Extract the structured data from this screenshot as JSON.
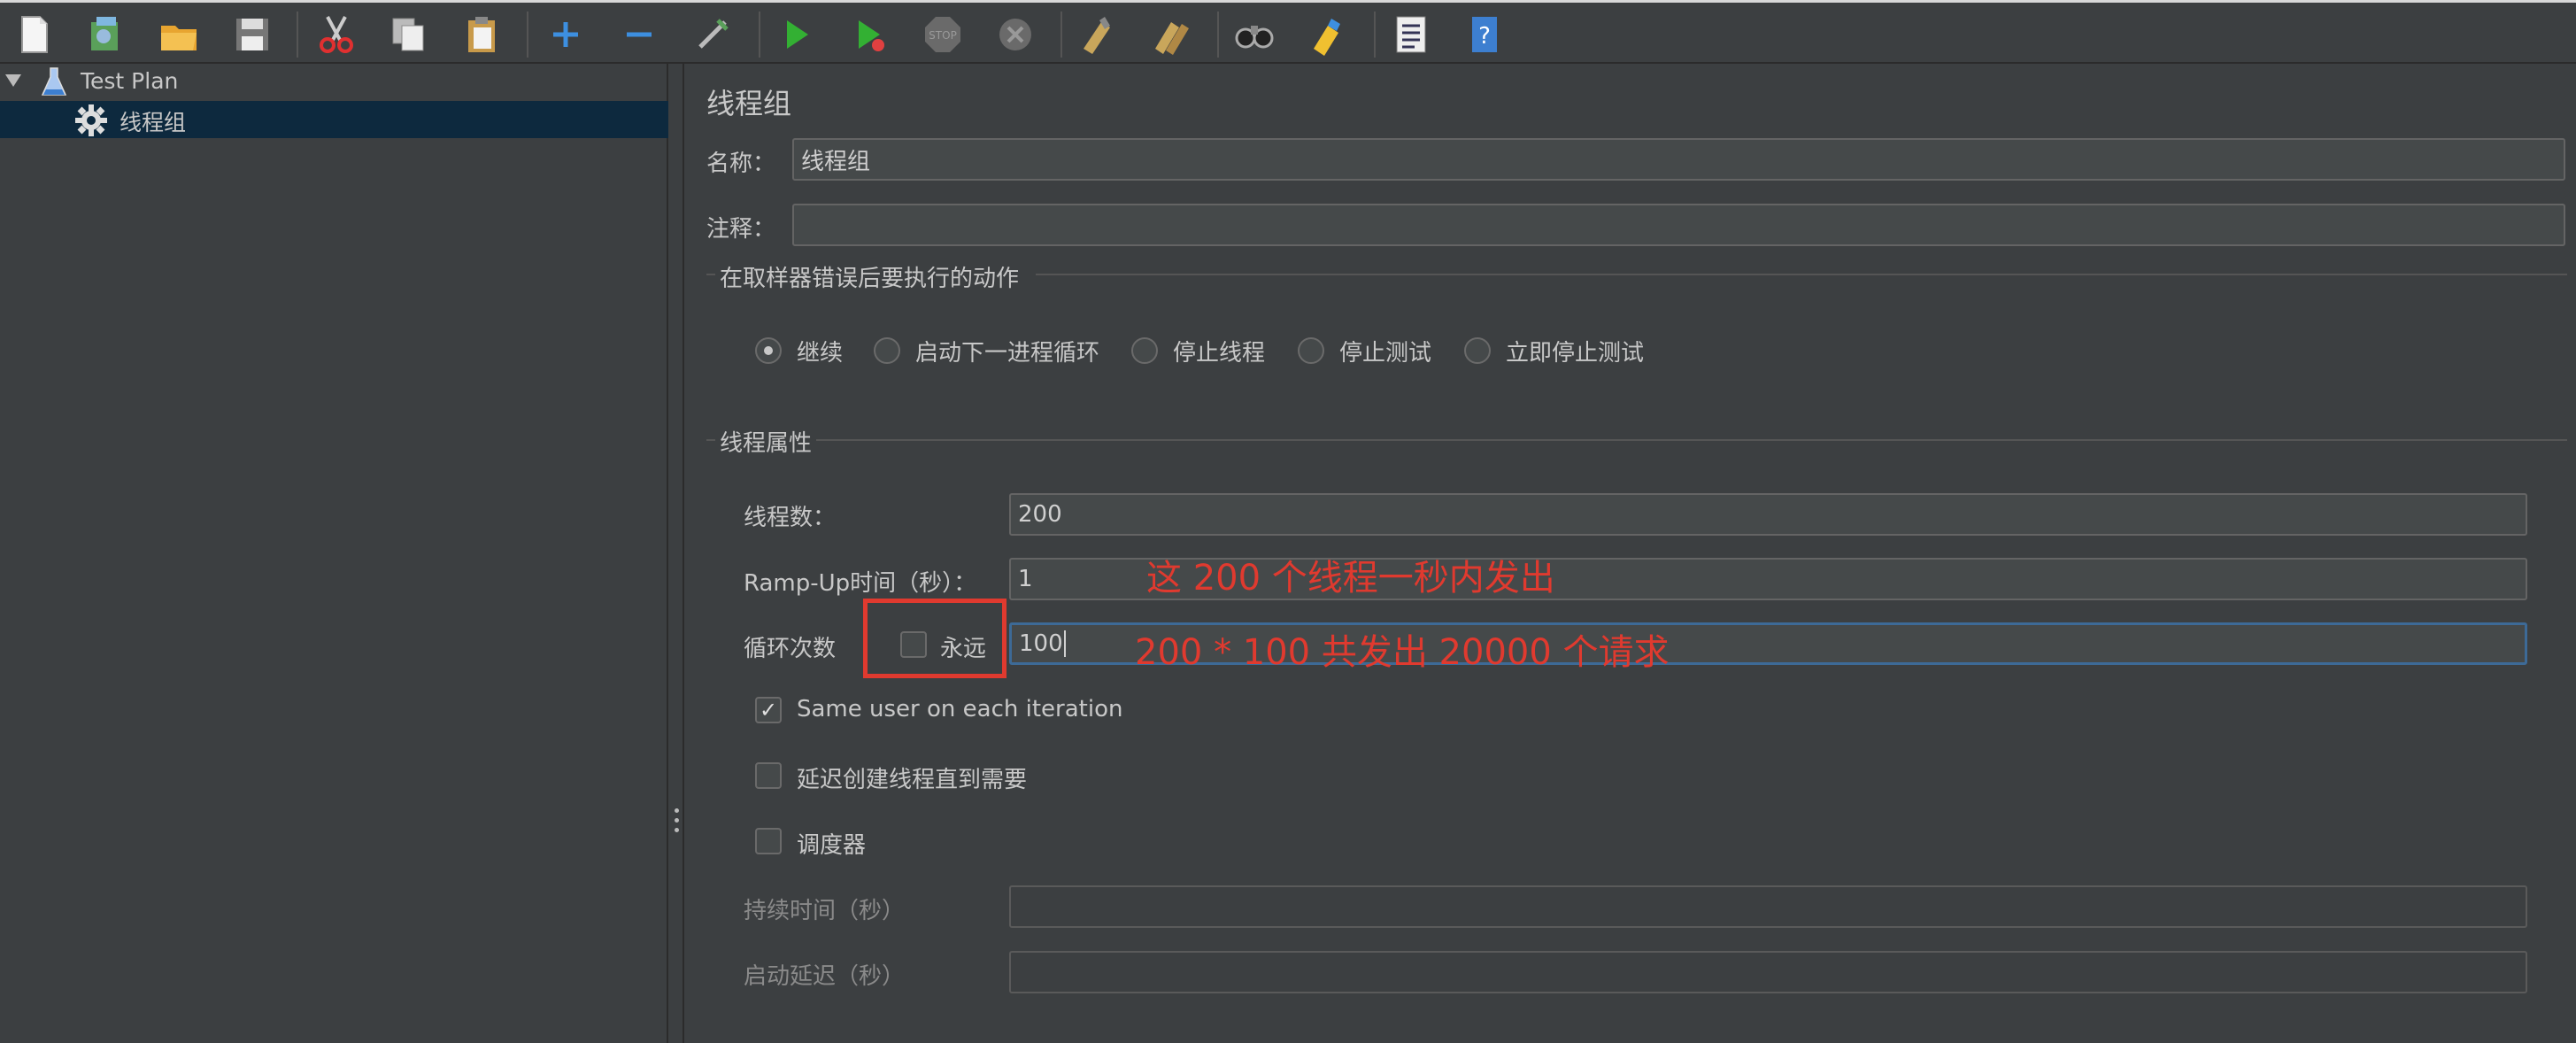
{
  "tree": {
    "root_label": "Test Plan",
    "child_label": "线程组"
  },
  "panel": {
    "title": "线程组",
    "name_label": "名称：",
    "name_value": "线程组",
    "comment_label": "注释：",
    "comment_value": ""
  },
  "sampler_error": {
    "section_title": "在取样器错误后要执行的动作",
    "options": [
      "继续",
      "启动下一进程循环",
      "停止线程",
      "停止测试",
      "立即停止测试"
    ],
    "selected_index": 0
  },
  "thread_props": {
    "section_title": "线程属性",
    "threads_label": "线程数：",
    "threads_value": "200",
    "rampup_label": "Ramp-Up时间（秒）：",
    "rampup_value": "1",
    "loop_label": "循环次数",
    "forever_label": "永远",
    "forever_checked": false,
    "loop_value": "100",
    "same_user_label": "Same user on each iteration",
    "same_user_checked": true,
    "delay_create_label": "延迟创建线程直到需要",
    "delay_create_checked": false,
    "scheduler_label": "调度器",
    "scheduler_checked": false,
    "duration_label": "持续时间（秒）",
    "duration_value": "",
    "startup_delay_label": "启动延迟（秒）",
    "startup_delay_value": ""
  },
  "annotations": {
    "rampup_note": "这 200 个线程一秒内发出",
    "loop_note": "200 * 100 共发出 20000 个请求"
  },
  "colors": {
    "background": "#3c3f41",
    "selection": "#0d293e",
    "annotation": "#e03a2f",
    "focus_border": "#3d6a97"
  }
}
